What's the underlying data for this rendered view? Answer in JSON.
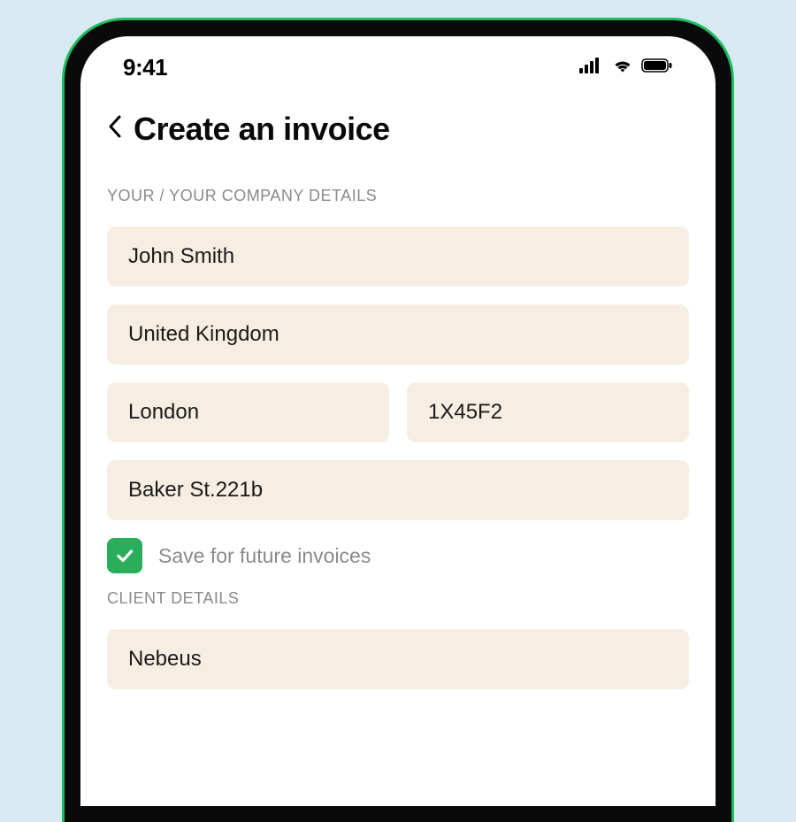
{
  "status": {
    "time": "9:41"
  },
  "header": {
    "title": "Create an invoice"
  },
  "company": {
    "section_label": "YOUR / YOUR COMPANY DETAILS",
    "name": "John Smith",
    "country": "United Kingdom",
    "city": "London",
    "postcode": "1X45F2",
    "address": "Baker St.221b"
  },
  "save": {
    "checked": true,
    "label": "Save for future invoices"
  },
  "client": {
    "section_label": "CLIENT DETAILS",
    "name": "Nebeus"
  },
  "colors": {
    "accent": "#2aae5c",
    "field_bg": "#f6eee2",
    "page_bg": "#d7eaf1"
  }
}
